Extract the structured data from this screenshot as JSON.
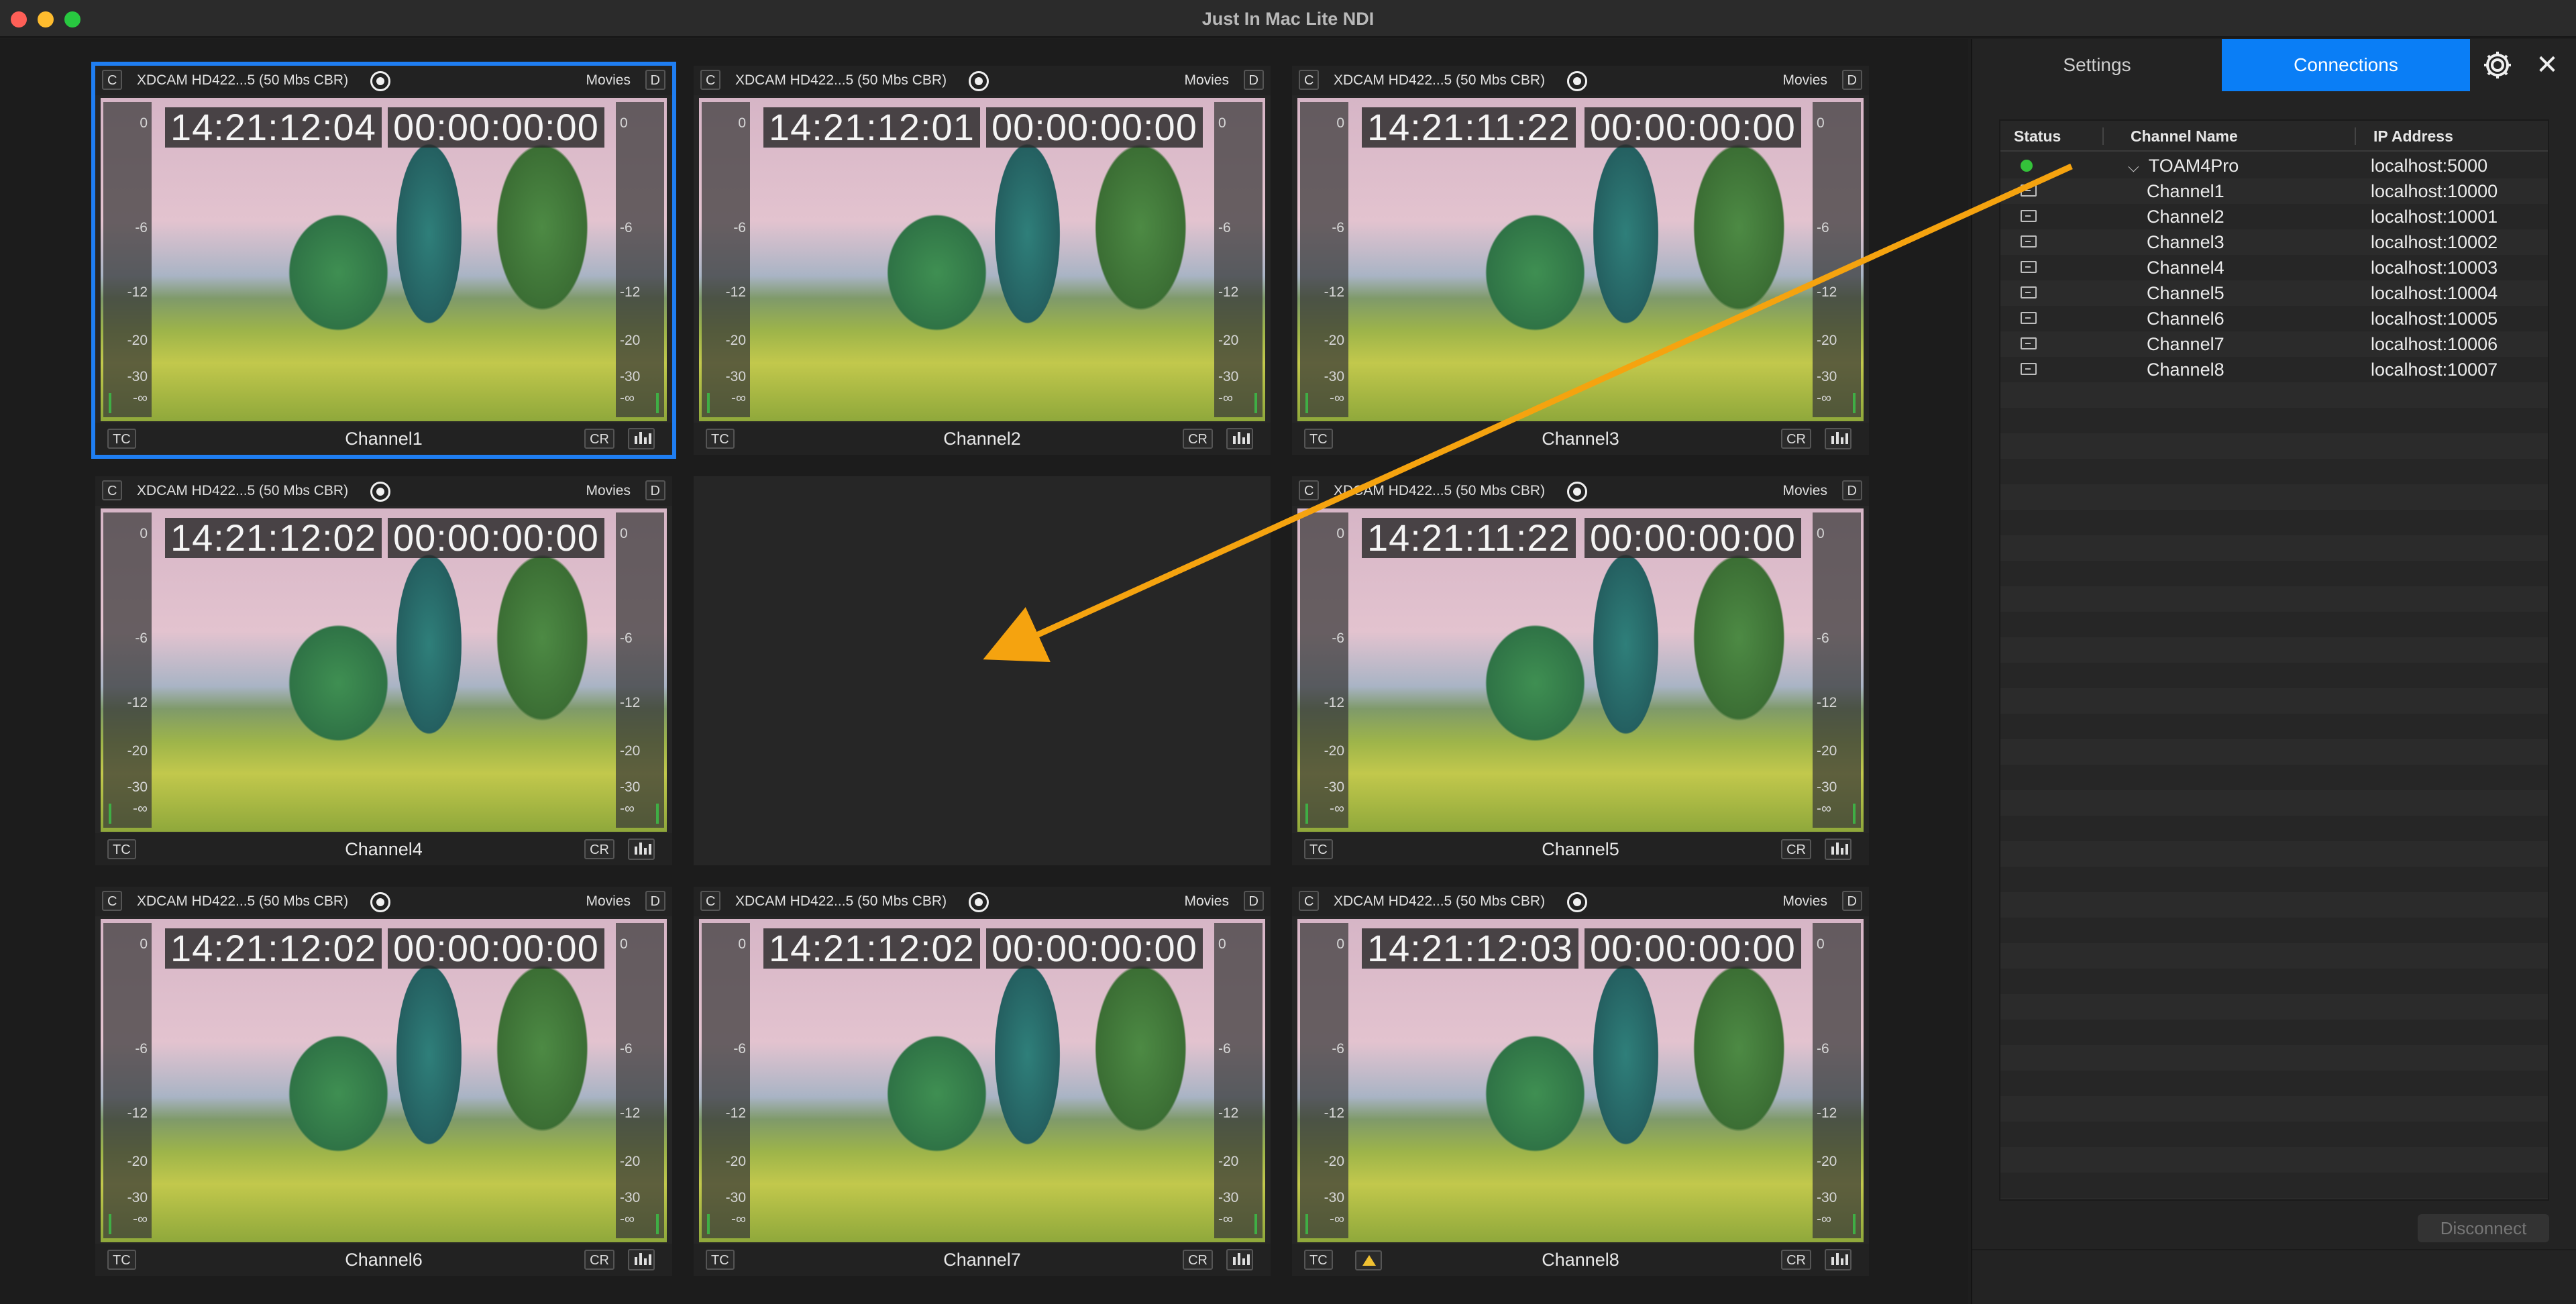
{
  "window": {
    "title": "Just In Mac Lite NDI"
  },
  "cells": [
    {
      "codec": "XDCAM HD422...5 (50 Mbs CBR)",
      "c_tag": "C",
      "source": "Movies",
      "d_tag": "D",
      "tc1": "14:21:12:04",
      "tc2": "00:00:00:00",
      "tc_tag": "TC",
      "cr_tag": "CR",
      "name": "Channel1",
      "selected": true
    },
    {
      "codec": "XDCAM HD422...5 (50 Mbs CBR)",
      "c_tag": "C",
      "source": "Movies",
      "d_tag": "D",
      "tc1": "14:21:12:01",
      "tc2": "00:00:00:00",
      "tc_tag": "TC",
      "cr_tag": "CR",
      "name": "Channel2"
    },
    {
      "codec": "XDCAM HD422...5 (50 Mbs CBR)",
      "c_tag": "C",
      "source": "Movies",
      "d_tag": "D",
      "tc1": "14:21:11:22",
      "tc2": "00:00:00:00",
      "tc_tag": "TC",
      "cr_tag": "CR",
      "name": "Channel3"
    },
    {
      "codec": "XDCAM HD422...5 (50 Mbs CBR)",
      "c_tag": "C",
      "source": "Movies",
      "d_tag": "D",
      "tc1": "14:21:12:02",
      "tc2": "00:00:00:00",
      "tc_tag": "TC",
      "cr_tag": "CR",
      "name": "Channel4"
    },
    {
      "empty": true
    },
    {
      "codec": "XDCAM HD422...5 (50 Mbs CBR)",
      "c_tag": "C",
      "source": "Movies",
      "d_tag": "D",
      "tc1": "14:21:11:22",
      "tc2": "00:00:00:00",
      "tc_tag": "TC",
      "cr_tag": "CR",
      "name": "Channel5"
    },
    {
      "codec": "XDCAM HD422...5 (50 Mbs CBR)",
      "c_tag": "C",
      "source": "Movies",
      "d_tag": "D",
      "tc1": "14:21:12:02",
      "tc2": "00:00:00:00",
      "tc_tag": "TC",
      "cr_tag": "CR",
      "name": "Channel6"
    },
    {
      "codec": "XDCAM HD422...5 (50 Mbs CBR)",
      "c_tag": "C",
      "source": "Movies",
      "d_tag": "D",
      "tc1": "14:21:12:02",
      "tc2": "00:00:00:00",
      "tc_tag": "TC",
      "cr_tag": "CR",
      "name": "Channel7"
    },
    {
      "codec": "XDCAM HD422...5 (50 Mbs CBR)",
      "c_tag": "C",
      "source": "Movies",
      "d_tag": "D",
      "tc1": "14:21:12:03",
      "tc2": "00:00:00:00",
      "tc_tag": "TC",
      "cr_tag": "CR",
      "name": "Channel8",
      "warning": true
    }
  ],
  "meter_scale": [
    "0",
    "-6",
    "-12",
    "-20",
    "-30",
    "-∞"
  ],
  "sidebar": {
    "tabs": [
      {
        "label": "Settings"
      },
      {
        "label": "Connections",
        "active": true
      }
    ],
    "icons": {
      "settings": "gear-icon",
      "close": "close-icon"
    },
    "close_glyph": "✕",
    "table": {
      "headers": {
        "status": "Status",
        "name": "Channel Name",
        "ip": "IP Address"
      },
      "rows": [
        {
          "type": "server",
          "status": "online",
          "name": "TOAM4Pro",
          "ip": "localhost:5000"
        },
        {
          "type": "channel",
          "name": "Channel1",
          "ip": "localhost:10000"
        },
        {
          "type": "channel",
          "name": "Channel2",
          "ip": "localhost:10001"
        },
        {
          "type": "channel",
          "name": "Channel3",
          "ip": "localhost:10002"
        },
        {
          "type": "channel",
          "name": "Channel4",
          "ip": "localhost:10003"
        },
        {
          "type": "channel",
          "name": "Channel5",
          "ip": "localhost:10004"
        },
        {
          "type": "channel",
          "name": "Channel6",
          "ip": "localhost:10005"
        },
        {
          "type": "channel",
          "name": "Channel7",
          "ip": "localhost:10006"
        },
        {
          "type": "channel",
          "name": "Channel8",
          "ip": "localhost:10007"
        }
      ],
      "blank_rows": 33
    },
    "disconnect_label": "Disconnect"
  },
  "colors": {
    "accent": "#0a7ef6",
    "selected_outline": "#1f7ef2",
    "status_online": "#34c23a",
    "arrow": "#f5a30f"
  }
}
